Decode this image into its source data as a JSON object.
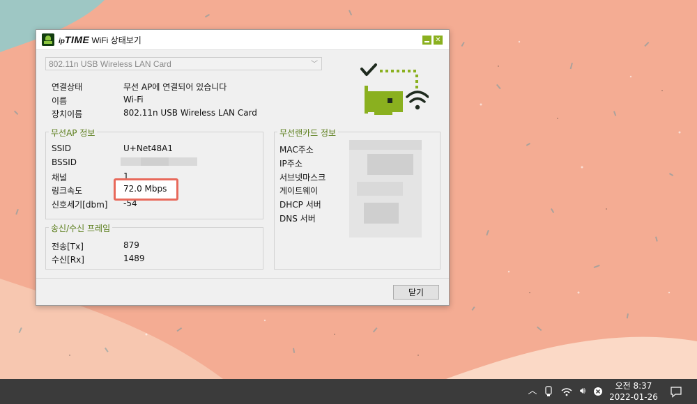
{
  "window": {
    "brand_ip": "ip",
    "brand_time": "TIME",
    "brand_subtitle": "WiFi 상태보기",
    "device_select": "802.11n USB Wireless LAN Card"
  },
  "connection": {
    "status_label": "연결상태",
    "status_value": "무선 AP에 연결되어 있습니다",
    "name_label": "이름",
    "name_value": "Wi-Fi",
    "device_label": "장치이름",
    "device_value": "802.11n USB Wireless LAN Card"
  },
  "ap_info": {
    "title": "무선AP 정보",
    "ssid_label": "SSID",
    "ssid_value": "U+Net48A1",
    "bssid_label": "BSSID",
    "channel_label": "채널",
    "channel_value": "1",
    "link_speed_label": "링크속도",
    "link_speed_value": "72.0 Mbps",
    "signal_label": "신호세기[dbm]",
    "signal_value": "-54"
  },
  "frames": {
    "title": "송신/수신 프레임",
    "tx_label": "전송[Tx]",
    "tx_value": "879",
    "rx_label": "수신[Rx]",
    "rx_value": "1489"
  },
  "card_info": {
    "title": "무선랜카드 정보",
    "mac_label": "MAC주소",
    "ip_label": "IP주소",
    "subnet_label": "서브넷마스크",
    "gateway_label": "게이트웨이",
    "dhcp_label": "DHCP 서버",
    "dns_label": "DNS 서버"
  },
  "buttons": {
    "close_label": "닫기"
  },
  "taskbar": {
    "time": "오전 8:37",
    "date": "2022-01-26"
  },
  "colors": {
    "accent_green": "#8ab01f",
    "highlight": "#e8695b",
    "desktop": "#f4ac93"
  }
}
